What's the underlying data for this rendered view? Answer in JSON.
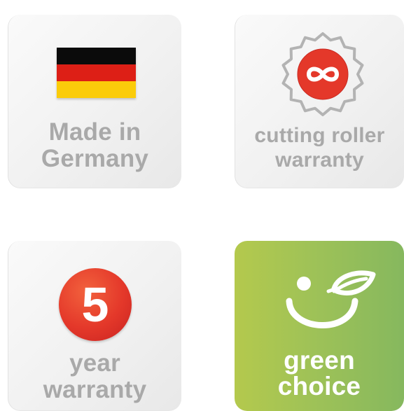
{
  "tiles": {
    "germany": {
      "line1": "Made in",
      "line2": "Germany",
      "icon": "germany-flag-icon",
      "flag_colors": [
        "#000000",
        "#dd0000",
        "#ffce00"
      ]
    },
    "roller": {
      "line1": "cutting roller",
      "line2": "warranty",
      "icon": "infinity-seal-icon"
    },
    "year": {
      "number": "5",
      "line1": "year",
      "line2": "warranty",
      "icon": "number-badge-icon"
    },
    "green": {
      "line1": "green",
      "line2": "choice",
      "icon": "leaf-smile-icon"
    }
  },
  "colors": {
    "tile_grey": "#f1f1f1",
    "caption_grey": "#a9a9a9",
    "badge_red": "#e4382a",
    "seal_grey": "#b3b3b3",
    "green_light": "#b4c94d",
    "green_dark": "#86b85e"
  }
}
